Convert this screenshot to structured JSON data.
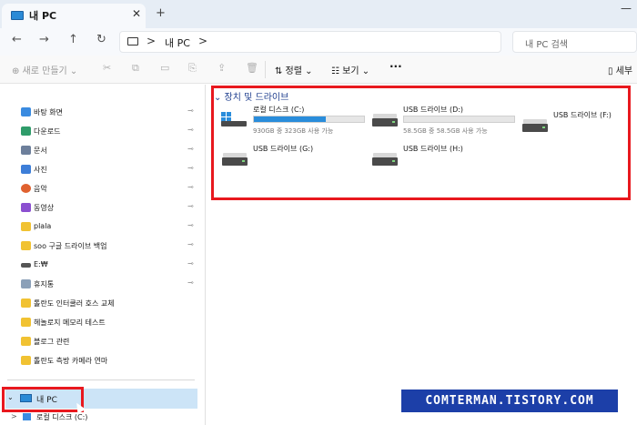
{
  "tab": {
    "title": "내 PC",
    "close": "✕",
    "new_tab": "+"
  },
  "window": {
    "minimize": "—"
  },
  "nav": {
    "back": "←",
    "forward": "→",
    "up": "↑",
    "refresh": "↻",
    "breadcrumb_sep": ">",
    "address_text": "내 PC",
    "breadcrumb_end": ">",
    "search_placeholder": "내 PC 검색"
  },
  "toolbar": {
    "new_label": "⊕ 새로 만들기 ⌄",
    "sort_label": "⇅ 정렬 ⌄",
    "view_label": "☷ 보기 ⌄",
    "more_label": "···",
    "detail_label": "▯ 세부"
  },
  "sidebar": {
    "items": [
      {
        "label": "바탕 화면",
        "color": "#3a8be0"
      },
      {
        "label": "다운로드",
        "color": "#2f9c6a"
      },
      {
        "label": "문서",
        "color": "#6d7f9b"
      },
      {
        "label": "사진",
        "color": "#3d7ed8"
      },
      {
        "label": "음악",
        "color": "#e0612f"
      },
      {
        "label": "동영상",
        "color": "#8b4fd0"
      },
      {
        "label": "plala",
        "color": "#f1c232"
      },
      {
        "label": "soo 구글 드라이브 백업",
        "color": "#f1c232"
      },
      {
        "label": "E:₩",
        "color": "#555555"
      },
      {
        "label": "휴지통",
        "color": "#8ba0b8"
      },
      {
        "label": "톨란도 인터쿨러 호스 교체",
        "color": "#f1c232"
      },
      {
        "label": "헤놀로지 메모리 테스트",
        "color": "#f1c232"
      },
      {
        "label": "블로그 관련",
        "color": "#f1c232"
      },
      {
        "label": "톨란도 측방 카메라 연마",
        "color": "#f1c232"
      }
    ],
    "pin_glyph": "📌",
    "mypc_label": "내 PC",
    "mypc_chevron": "⌄",
    "local_label": "로컬 디스크 (C:)",
    "local_chevron": ">"
  },
  "main": {
    "section_title": "⌄ 장치 및 드라이브",
    "drives": [
      {
        "name": "로컬 디스크 (C:)",
        "free": "930GB 중 323GB 사용 가능",
        "used_fraction": 0.65,
        "icon": "windows-drive-icon"
      },
      {
        "name": "USB 드라이브 (D:)",
        "free": "58.5GB 중 58.5GB 사용 가능",
        "used_fraction": 0.0,
        "icon": "usb-drive-icon"
      },
      {
        "name": "USB 드라이브 (F:)",
        "icon": "usb-drive-icon"
      },
      {
        "name": "USB 드라이브 (G:)",
        "icon": "usb-drive-icon"
      },
      {
        "name": "USB 드라이브 (H:)",
        "icon": "usb-drive-icon"
      }
    ]
  },
  "watermark": "COMTERMAN.TISTORY.COM"
}
